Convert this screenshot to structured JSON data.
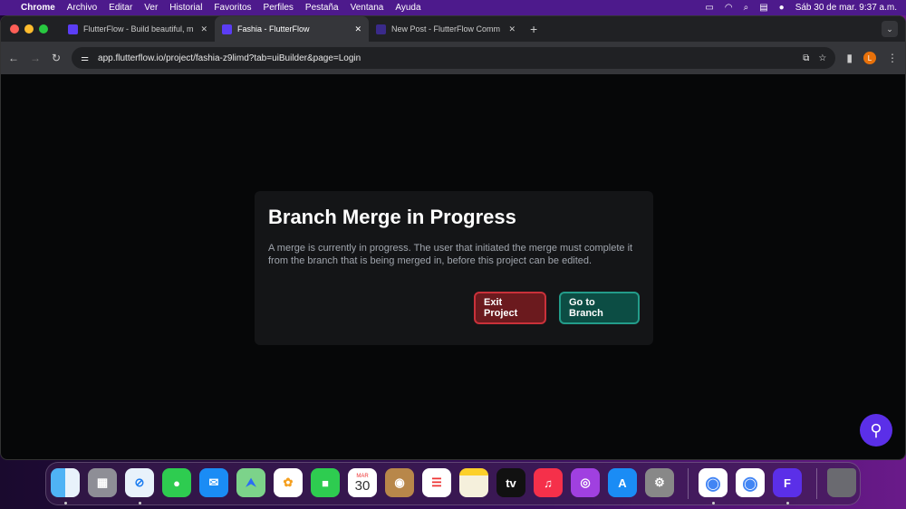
{
  "menubar": {
    "app": "Chrome",
    "items": [
      "Archivo",
      "Editar",
      "Ver",
      "Historial",
      "Favoritos",
      "Perfiles",
      "Pestaña",
      "Ventana",
      "Ayuda"
    ],
    "datetime": "Sáb 30 de mar.  9:37 a.m."
  },
  "tabs": [
    {
      "title": "FlutterFlow - Build beautiful, m"
    },
    {
      "title": "Fashia - FlutterFlow"
    },
    {
      "title": "New Post - FlutterFlow Comm"
    }
  ],
  "address": "app.flutterflow.io/project/fashia-z9limd?tab=uiBuilder&page=Login",
  "profile_initial": "L",
  "dialog": {
    "title": "Branch Merge in Progress",
    "message": "A merge is currently in progress. The user that initiated the merge must complete it from the branch that is being merged in, before this project can be edited.",
    "exit_label": "Exit Project",
    "go_label": "Go to Branch"
  },
  "dock": {
    "calendar_month": "MAR",
    "calendar_day": "30",
    "tv_label": "tv"
  },
  "colors": {
    "exit": "#c9313a",
    "go": "#239c8a",
    "accent": "#5b2fe8"
  }
}
